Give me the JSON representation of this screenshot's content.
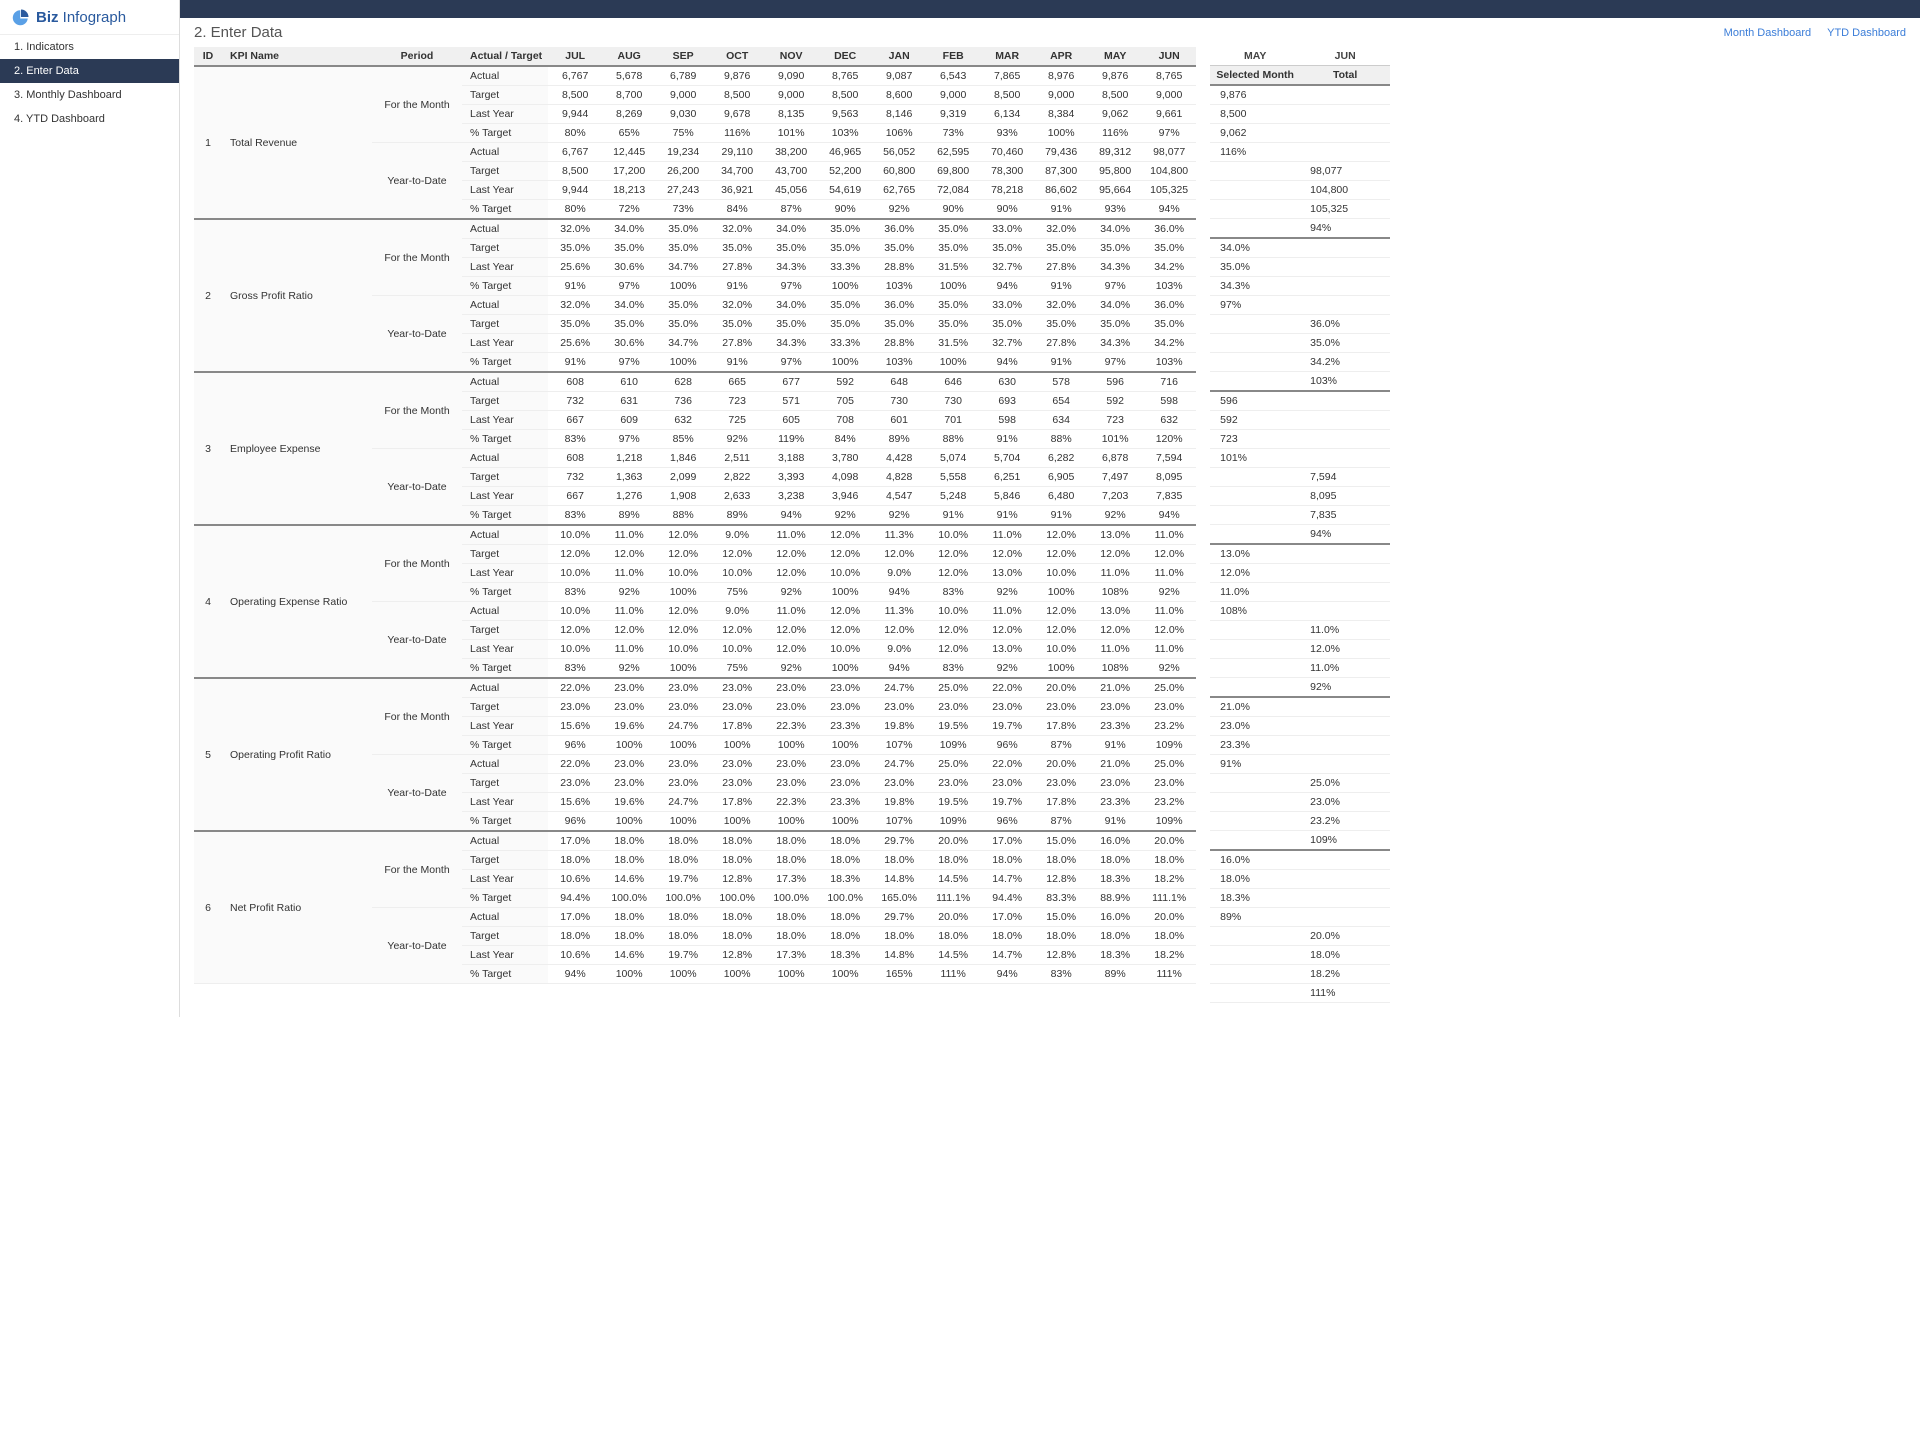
{
  "logo": {
    "biz": "Biz",
    "info": "Infograph"
  },
  "nav": [
    {
      "label": "1. Indicators",
      "active": false
    },
    {
      "label": "2. Enter Data",
      "active": true
    },
    {
      "label": "3. Monthly Dashboard",
      "active": false
    },
    {
      "label": "4. YTD Dashboard",
      "active": false
    }
  ],
  "pageTitle": "2. Enter Data",
  "links": {
    "month": "Month Dashboard",
    "ytd": "YTD Dashboard"
  },
  "columns": {
    "id": "ID",
    "kpi": "KPI Name",
    "period": "Period",
    "metric": "Actual / Target",
    "months": [
      "JUL",
      "AUG",
      "SEP",
      "OCT",
      "NOV",
      "DEC",
      "JAN",
      "FEB",
      "MAR",
      "APR",
      "MAY",
      "JUN"
    ]
  },
  "side": {
    "topHeaders": [
      "MAY",
      "JUN"
    ],
    "headers": [
      "Selected Month",
      "Total"
    ]
  },
  "periods": {
    "month": "For the Month",
    "ytd": "Year-to-Date"
  },
  "metrics": [
    "Actual",
    "Target",
    "Last Year",
    "% Target"
  ],
  "kpis": [
    {
      "id": "1",
      "name": "Total Revenue",
      "month": [
        [
          "6,767",
          "5,678",
          "6,789",
          "9,876",
          "9,090",
          "8,765",
          "9,087",
          "6,543",
          "7,865",
          "8,976",
          "9,876",
          "8,765"
        ],
        [
          "8,500",
          "8,700",
          "9,000",
          "8,500",
          "9,000",
          "8,500",
          "8,600",
          "9,000",
          "8,500",
          "9,000",
          "8,500",
          "9,000"
        ],
        [
          "9,944",
          "8,269",
          "9,030",
          "9,678",
          "8,135",
          "9,563",
          "8,146",
          "9,319",
          "6,134",
          "8,384",
          "9,062",
          "9,661"
        ],
        [
          "80%",
          "65%",
          "75%",
          "116%",
          "101%",
          "103%",
          "106%",
          "73%",
          "93%",
          "100%",
          "116%",
          "97%"
        ]
      ],
      "ytd": [
        [
          "6,767",
          "12,445",
          "19,234",
          "29,110",
          "38,200",
          "46,965",
          "56,052",
          "62,595",
          "70,460",
          "79,436",
          "89,312",
          "98,077"
        ],
        [
          "8,500",
          "17,200",
          "26,200",
          "34,700",
          "43,700",
          "52,200",
          "60,800",
          "69,800",
          "78,300",
          "87,300",
          "95,800",
          "104,800"
        ],
        [
          "9,944",
          "18,213",
          "27,243",
          "36,921",
          "45,056",
          "54,619",
          "62,765",
          "72,084",
          "78,218",
          "86,602",
          "95,664",
          "105,325"
        ],
        [
          "80%",
          "72%",
          "73%",
          "84%",
          "87%",
          "90%",
          "92%",
          "90%",
          "90%",
          "91%",
          "93%",
          "94%"
        ]
      ],
      "sideMonth": [
        "9,876",
        "8,500",
        "9,062",
        "116%"
      ],
      "sideYtd": [
        "98,077",
        "104,800",
        "105,325",
        "94%"
      ]
    },
    {
      "id": "2",
      "name": "Gross Profit Ratio",
      "month": [
        [
          "32.0%",
          "34.0%",
          "35.0%",
          "32.0%",
          "34.0%",
          "35.0%",
          "36.0%",
          "35.0%",
          "33.0%",
          "32.0%",
          "34.0%",
          "36.0%"
        ],
        [
          "35.0%",
          "35.0%",
          "35.0%",
          "35.0%",
          "35.0%",
          "35.0%",
          "35.0%",
          "35.0%",
          "35.0%",
          "35.0%",
          "35.0%",
          "35.0%"
        ],
        [
          "25.6%",
          "30.6%",
          "34.7%",
          "27.8%",
          "34.3%",
          "33.3%",
          "28.8%",
          "31.5%",
          "32.7%",
          "27.8%",
          "34.3%",
          "34.2%"
        ],
        [
          "91%",
          "97%",
          "100%",
          "91%",
          "97%",
          "100%",
          "103%",
          "100%",
          "94%",
          "91%",
          "97%",
          "103%"
        ]
      ],
      "ytd": [
        [
          "32.0%",
          "34.0%",
          "35.0%",
          "32.0%",
          "34.0%",
          "35.0%",
          "36.0%",
          "35.0%",
          "33.0%",
          "32.0%",
          "34.0%",
          "36.0%"
        ],
        [
          "35.0%",
          "35.0%",
          "35.0%",
          "35.0%",
          "35.0%",
          "35.0%",
          "35.0%",
          "35.0%",
          "35.0%",
          "35.0%",
          "35.0%",
          "35.0%"
        ],
        [
          "25.6%",
          "30.6%",
          "34.7%",
          "27.8%",
          "34.3%",
          "33.3%",
          "28.8%",
          "31.5%",
          "32.7%",
          "27.8%",
          "34.3%",
          "34.2%"
        ],
        [
          "91%",
          "97%",
          "100%",
          "91%",
          "97%",
          "100%",
          "103%",
          "100%",
          "94%",
          "91%",
          "97%",
          "103%"
        ]
      ],
      "sideMonth": [
        "34.0%",
        "35.0%",
        "34.3%",
        "97%"
      ],
      "sideYtd": [
        "36.0%",
        "35.0%",
        "34.2%",
        "103%"
      ]
    },
    {
      "id": "3",
      "name": "Employee Expense",
      "month": [
        [
          "608",
          "610",
          "628",
          "665",
          "677",
          "592",
          "648",
          "646",
          "630",
          "578",
          "596",
          "716"
        ],
        [
          "732",
          "631",
          "736",
          "723",
          "571",
          "705",
          "730",
          "730",
          "693",
          "654",
          "592",
          "598"
        ],
        [
          "667",
          "609",
          "632",
          "725",
          "605",
          "708",
          "601",
          "701",
          "598",
          "634",
          "723",
          "632"
        ],
        [
          "83%",
          "97%",
          "85%",
          "92%",
          "119%",
          "84%",
          "89%",
          "88%",
          "91%",
          "88%",
          "101%",
          "120%"
        ]
      ],
      "ytd": [
        [
          "608",
          "1,218",
          "1,846",
          "2,511",
          "3,188",
          "3,780",
          "4,428",
          "5,074",
          "5,704",
          "6,282",
          "6,878",
          "7,594"
        ],
        [
          "732",
          "1,363",
          "2,099",
          "2,822",
          "3,393",
          "4,098",
          "4,828",
          "5,558",
          "6,251",
          "6,905",
          "7,497",
          "8,095"
        ],
        [
          "667",
          "1,276",
          "1,908",
          "2,633",
          "3,238",
          "3,946",
          "4,547",
          "5,248",
          "5,846",
          "6,480",
          "7,203",
          "7,835"
        ],
        [
          "83%",
          "89%",
          "88%",
          "89%",
          "94%",
          "92%",
          "92%",
          "91%",
          "91%",
          "91%",
          "92%",
          "94%"
        ]
      ],
      "sideMonth": [
        "596",
        "592",
        "723",
        "101%"
      ],
      "sideYtd": [
        "7,594",
        "8,095",
        "7,835",
        "94%"
      ]
    },
    {
      "id": "4",
      "name": "Operating Expense Ratio",
      "month": [
        [
          "10.0%",
          "11.0%",
          "12.0%",
          "9.0%",
          "11.0%",
          "12.0%",
          "11.3%",
          "10.0%",
          "11.0%",
          "12.0%",
          "13.0%",
          "11.0%"
        ],
        [
          "12.0%",
          "12.0%",
          "12.0%",
          "12.0%",
          "12.0%",
          "12.0%",
          "12.0%",
          "12.0%",
          "12.0%",
          "12.0%",
          "12.0%",
          "12.0%"
        ],
        [
          "10.0%",
          "11.0%",
          "10.0%",
          "10.0%",
          "12.0%",
          "10.0%",
          "9.0%",
          "12.0%",
          "13.0%",
          "10.0%",
          "11.0%",
          "11.0%"
        ],
        [
          "83%",
          "92%",
          "100%",
          "75%",
          "92%",
          "100%",
          "94%",
          "83%",
          "92%",
          "100%",
          "108%",
          "92%"
        ]
      ],
      "ytd": [
        [
          "10.0%",
          "11.0%",
          "12.0%",
          "9.0%",
          "11.0%",
          "12.0%",
          "11.3%",
          "10.0%",
          "11.0%",
          "12.0%",
          "13.0%",
          "11.0%"
        ],
        [
          "12.0%",
          "12.0%",
          "12.0%",
          "12.0%",
          "12.0%",
          "12.0%",
          "12.0%",
          "12.0%",
          "12.0%",
          "12.0%",
          "12.0%",
          "12.0%"
        ],
        [
          "10.0%",
          "11.0%",
          "10.0%",
          "10.0%",
          "12.0%",
          "10.0%",
          "9.0%",
          "12.0%",
          "13.0%",
          "10.0%",
          "11.0%",
          "11.0%"
        ],
        [
          "83%",
          "92%",
          "100%",
          "75%",
          "92%",
          "100%",
          "94%",
          "83%",
          "92%",
          "100%",
          "108%",
          "92%"
        ]
      ],
      "sideMonth": [
        "13.0%",
        "12.0%",
        "11.0%",
        "108%"
      ],
      "sideYtd": [
        "11.0%",
        "12.0%",
        "11.0%",
        "92%"
      ]
    },
    {
      "id": "5",
      "name": "Operating Profit Ratio",
      "month": [
        [
          "22.0%",
          "23.0%",
          "23.0%",
          "23.0%",
          "23.0%",
          "23.0%",
          "24.7%",
          "25.0%",
          "22.0%",
          "20.0%",
          "21.0%",
          "25.0%"
        ],
        [
          "23.0%",
          "23.0%",
          "23.0%",
          "23.0%",
          "23.0%",
          "23.0%",
          "23.0%",
          "23.0%",
          "23.0%",
          "23.0%",
          "23.0%",
          "23.0%"
        ],
        [
          "15.6%",
          "19.6%",
          "24.7%",
          "17.8%",
          "22.3%",
          "23.3%",
          "19.8%",
          "19.5%",
          "19.7%",
          "17.8%",
          "23.3%",
          "23.2%"
        ],
        [
          "96%",
          "100%",
          "100%",
          "100%",
          "100%",
          "100%",
          "107%",
          "109%",
          "96%",
          "87%",
          "91%",
          "109%"
        ]
      ],
      "ytd": [
        [
          "22.0%",
          "23.0%",
          "23.0%",
          "23.0%",
          "23.0%",
          "23.0%",
          "24.7%",
          "25.0%",
          "22.0%",
          "20.0%",
          "21.0%",
          "25.0%"
        ],
        [
          "23.0%",
          "23.0%",
          "23.0%",
          "23.0%",
          "23.0%",
          "23.0%",
          "23.0%",
          "23.0%",
          "23.0%",
          "23.0%",
          "23.0%",
          "23.0%"
        ],
        [
          "15.6%",
          "19.6%",
          "24.7%",
          "17.8%",
          "22.3%",
          "23.3%",
          "19.8%",
          "19.5%",
          "19.7%",
          "17.8%",
          "23.3%",
          "23.2%"
        ],
        [
          "96%",
          "100%",
          "100%",
          "100%",
          "100%",
          "100%",
          "107%",
          "109%",
          "96%",
          "87%",
          "91%",
          "109%"
        ]
      ],
      "sideMonth": [
        "21.0%",
        "23.0%",
        "23.3%",
        "91%"
      ],
      "sideYtd": [
        "25.0%",
        "23.0%",
        "23.2%",
        "109%"
      ]
    },
    {
      "id": "6",
      "name": "Net Profit Ratio",
      "month": [
        [
          "17.0%",
          "18.0%",
          "18.0%",
          "18.0%",
          "18.0%",
          "18.0%",
          "29.7%",
          "20.0%",
          "17.0%",
          "15.0%",
          "16.0%",
          "20.0%"
        ],
        [
          "18.0%",
          "18.0%",
          "18.0%",
          "18.0%",
          "18.0%",
          "18.0%",
          "18.0%",
          "18.0%",
          "18.0%",
          "18.0%",
          "18.0%",
          "18.0%"
        ],
        [
          "10.6%",
          "14.6%",
          "19.7%",
          "12.8%",
          "17.3%",
          "18.3%",
          "14.8%",
          "14.5%",
          "14.7%",
          "12.8%",
          "18.3%",
          "18.2%"
        ],
        [
          "94.4%",
          "100.0%",
          "100.0%",
          "100.0%",
          "100.0%",
          "100.0%",
          "165.0%",
          "111.1%",
          "94.4%",
          "83.3%",
          "88.9%",
          "111.1%"
        ]
      ],
      "ytd": [
        [
          "17.0%",
          "18.0%",
          "18.0%",
          "18.0%",
          "18.0%",
          "18.0%",
          "29.7%",
          "20.0%",
          "17.0%",
          "15.0%",
          "16.0%",
          "20.0%"
        ],
        [
          "18.0%",
          "18.0%",
          "18.0%",
          "18.0%",
          "18.0%",
          "18.0%",
          "18.0%",
          "18.0%",
          "18.0%",
          "18.0%",
          "18.0%",
          "18.0%"
        ],
        [
          "10.6%",
          "14.6%",
          "19.7%",
          "12.8%",
          "17.3%",
          "18.3%",
          "14.8%",
          "14.5%",
          "14.7%",
          "12.8%",
          "18.3%",
          "18.2%"
        ],
        [
          "94%",
          "100%",
          "100%",
          "100%",
          "100%",
          "100%",
          "165%",
          "111%",
          "94%",
          "83%",
          "89%",
          "111%"
        ]
      ],
      "sideMonth": [
        "16.0%",
        "18.0%",
        "18.3%",
        "89%"
      ],
      "sideYtd": [
        "20.0%",
        "18.0%",
        "18.2%",
        "111%"
      ]
    }
  ]
}
